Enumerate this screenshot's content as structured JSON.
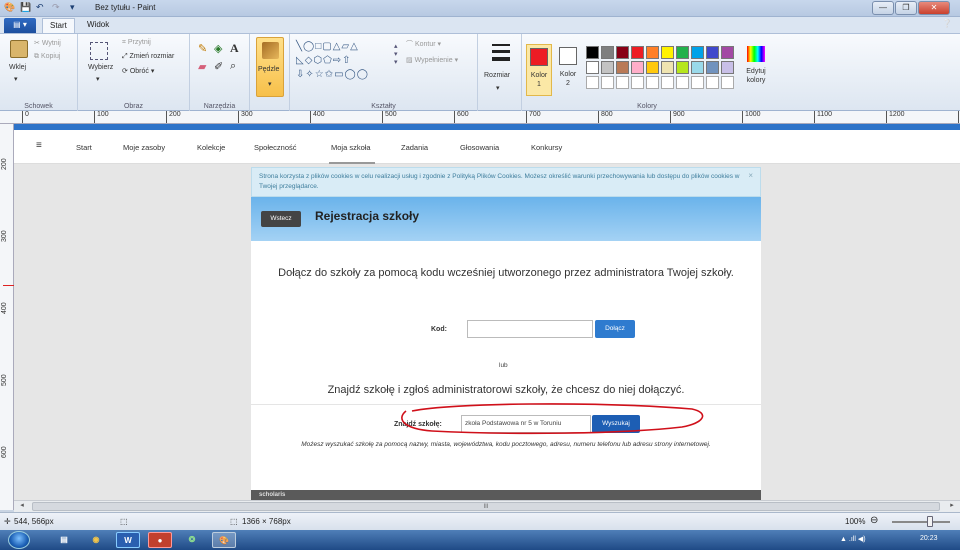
{
  "window": {
    "title": "Bez tytułu - Paint"
  },
  "quick_access": {
    "save": "💾",
    "undo": "↶",
    "redo": "↷",
    "dropdown": "▾"
  },
  "tabs": {
    "file": "▤ ▾",
    "start": "Start",
    "view": "Widok"
  },
  "ribbon": {
    "clipboard": {
      "paste": "Wklej",
      "cut": "Wytnij",
      "copy": "Kopiuj",
      "label": "Schowek"
    },
    "image": {
      "select": "Wybierz",
      "crop": "Przytnij",
      "resize": "Zmień rozmiar",
      "rotate": "Obróć ▾",
      "label": "Obraz"
    },
    "tools": {
      "label": "Narzędzia"
    },
    "brushes": {
      "label": "Pędzle"
    },
    "shapes": {
      "outline": "Kontur ▾",
      "fill": "Wypełnienie ▾",
      "label": "Kształty"
    },
    "size": {
      "label": "Rozmiar"
    },
    "colors": {
      "color1": "Kolor 1",
      "color2": "Kolor 2",
      "edit": "Edytuj kolory",
      "label": "Kolory",
      "row1": [
        "#000000",
        "#7f7f7f",
        "#880015",
        "#ed1c24",
        "#ff7f27",
        "#fff200",
        "#22b14c",
        "#00a2e8",
        "#3f48cc",
        "#a349a4"
      ],
      "row2": [
        "#ffffff",
        "#c3c3c3",
        "#b97a57",
        "#ffaec9",
        "#ffc90e",
        "#efe4b0",
        "#b5e61d",
        "#99d9ea",
        "#7092be",
        "#c8bfe7"
      ],
      "color1_value": "#ed1c24",
      "color2_value": "#ffffff"
    }
  },
  "ruler": {
    "marks": [
      "0",
      "100",
      "200",
      "300",
      "400",
      "500",
      "600",
      "700",
      "800",
      "900",
      "1000",
      "1100",
      "1200",
      "1300"
    ],
    "vmarks": [
      "200",
      "300",
      "400",
      "500",
      "600"
    ]
  },
  "website": {
    "nav": [
      "Start",
      "Moje zasoby",
      "Kolekcje",
      "Społeczność",
      "Moja szkoła",
      "Zadania",
      "Głosowania",
      "Konkursy"
    ],
    "menu_icon": "≡",
    "cookie_text": "Strona korzysta z plików cookies w celu realizacji usług i zgodnie z Polityką Plików Cookies. Możesz określić warunki przechowywania lub dostępu do plików cookies w Twojej przeglądarce.",
    "cookie_close": "×",
    "back_button": "Wstecz",
    "page_title": "Rejestracja szkoły",
    "join_text": "Dołącz do szkoły za pomocą kodu wcześniej utworzonego przez administratora Twojej szkoły.",
    "code_label": "Kod:",
    "code_value": "",
    "join_button": "Dołącz",
    "or_text": "lub",
    "find_text": "Znajdź szkołę i zgłoś administratorowi szkoły, że chcesz do niej dołączyć.",
    "find_label": "Znajdź szkołę:",
    "find_value": "zkoła Podstawowa nr 5 w Toruniu",
    "search_button": "Wyszukaj",
    "hint": "Możesz wyszukać szkołę za pomocą nazwy, miasta, województwa, kodu pocztowego, adresu, numeru telefonu lub adresu strony internetowej.",
    "footer_logo": "scholaris"
  },
  "scrollbar": {
    "grip": "III",
    "left": "◂",
    "right": "▸"
  },
  "status": {
    "cursor": "544, 566px",
    "dimensions": "1366 × 768px",
    "zoom": "100%",
    "zoom_out": "⊖"
  },
  "taskbar": {
    "time": "20:23",
    "tray": "▲ .ıll ◀)"
  }
}
